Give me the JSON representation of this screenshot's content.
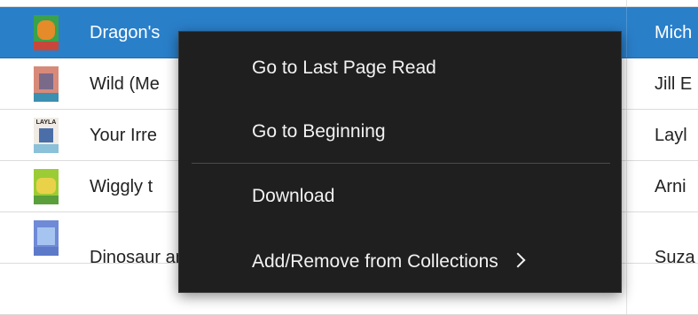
{
  "library": {
    "rows": [
      {
        "title": "Dragon's",
        "author": "Mich",
        "selected": true
      },
      {
        "title": "Wild (Me",
        "author": "Jill E"
      },
      {
        "title": "Your Irre",
        "author": "Layl"
      },
      {
        "title": "Wiggly t",
        "author": "Arni"
      },
      {
        "title": "Dinosaur and Monster and The Magic Carpet (D...",
        "author": "Suza"
      }
    ],
    "cover_colors": [
      [
        "#3aa24a",
        "#e58b2a",
        "#c9473a"
      ],
      [
        "#d88a7a",
        "#7a6a8a",
        "#3c8fb0"
      ],
      [
        "#f0ebe4",
        "#4a6fa8",
        "#8bc1d9"
      ],
      [
        "#9ccc35",
        "#e9d24a",
        "#5a9f3a"
      ],
      [
        "#6f8ad6",
        "#a6c4f0",
        "#5d7ac9"
      ]
    ],
    "cover_top_text": "LAYLA"
  },
  "context_menu": {
    "items": [
      {
        "label": "Go to Last Page Read"
      },
      {
        "label": "Go to Beginning"
      },
      {
        "label": "Download"
      },
      {
        "label": "Add/Remove from Collections",
        "submenu": true
      }
    ]
  },
  "colors": {
    "selected_row": "#2a7fc9",
    "menu_bg": "#1f1f1f",
    "menu_text": "#f2f2f2"
  }
}
